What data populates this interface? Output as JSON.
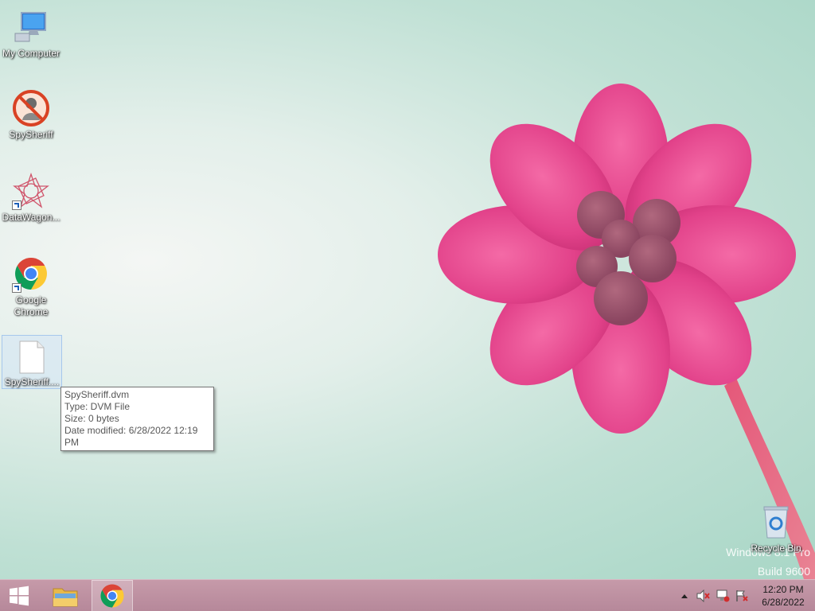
{
  "desktop": {
    "icons": [
      {
        "label": "My Computer",
        "icon": "computer-icon"
      },
      {
        "label": "SpySheriff",
        "icon": "spysheriff-icon"
      },
      {
        "label": "DataWagon...",
        "icon": "datawagon-icon"
      },
      {
        "label": "Google Chrome",
        "icon": "chrome-icon"
      },
      {
        "label": "SpySheriff....",
        "icon": "document-icon"
      },
      {
        "label": "Recycle Bin",
        "icon": "recycle-bin-icon"
      }
    ],
    "watermark": {
      "edition": "Windows 8.1 Pro",
      "build": "Build 9600"
    }
  },
  "tooltip": {
    "name": "SpySheriff.dvm",
    "type": "Type: DVM File",
    "size": "Size: 0 bytes",
    "modified": "Date modified: 6/28/2022 12:19 PM"
  },
  "taskbar": {
    "start_icon": "windows-logo-icon",
    "pinned": [
      "file-explorer-icon",
      "chrome-icon"
    ],
    "tray_icons": [
      "show-hidden-icons-arrow",
      "volume-muted-icon",
      "network-disconnected-icon",
      "action-center-flag-icon"
    ],
    "clock": {
      "time": "12:20 PM",
      "date": "6/28/2022"
    }
  },
  "colors": {
    "taskbar": "#c69aa9",
    "flower": "#e8458a",
    "wallpaper": "#bfe0d4"
  }
}
